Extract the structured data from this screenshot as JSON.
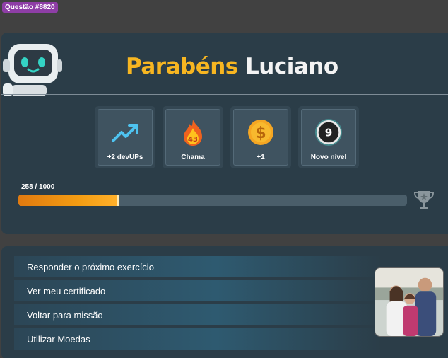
{
  "question_badge": "Questão #8820",
  "title": {
    "prefix": "Parabéns",
    "name": "Luciano"
  },
  "stats": [
    {
      "icon": "trending-up-icon",
      "label": "+2 devUPs"
    },
    {
      "icon": "flame-icon",
      "label": "Chama",
      "value": "43"
    },
    {
      "icon": "coin-icon",
      "label": "+1",
      "symbol": "$"
    },
    {
      "icon": "level-ring-icon",
      "label": "Novo nível",
      "value": "9"
    }
  ],
  "progress": {
    "text": "258 / 1000",
    "current": 258,
    "max": 1000
  },
  "menu": [
    {
      "label": "Responder o próximo exercício"
    },
    {
      "label": "Ver meu certificado"
    },
    {
      "label": "Voltar para missão"
    },
    {
      "label": "Utilizar Moedas"
    }
  ],
  "colors": {
    "accent": "#f7b621",
    "card": "#2b3d48",
    "badge": "#8e3ea6",
    "progress": "#f39c12"
  }
}
